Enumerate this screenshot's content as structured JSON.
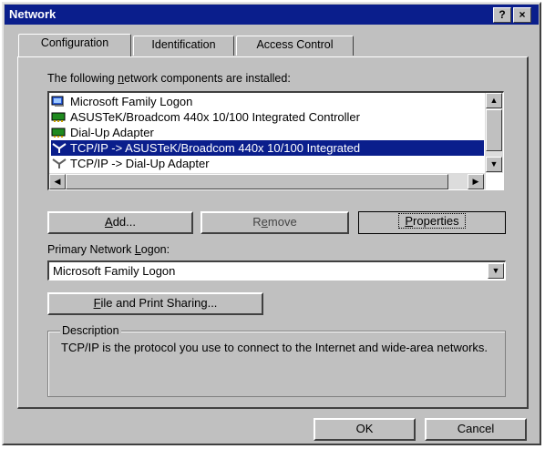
{
  "window": {
    "title": "Network",
    "help_button": "?",
    "close_button": "×"
  },
  "tabs": [
    {
      "label": "Configuration",
      "active": true
    },
    {
      "label": "Identification",
      "active": false
    },
    {
      "label": "Access Control",
      "active": false
    }
  ],
  "components": {
    "label_pre": "The following ",
    "label_mnemonic": "n",
    "label_post": "etwork components are installed:",
    "items": [
      {
        "label": "Microsoft Family Logon",
        "icon": "client-icon",
        "selected": false
      },
      {
        "label": "ASUSTeK/Broadcom 440x 10/100 Integrated Controller",
        "icon": "network-adapter-icon",
        "selected": false
      },
      {
        "label": "Dial-Up Adapter",
        "icon": "network-adapter-icon",
        "selected": false
      },
      {
        "label": "TCP/IP -> ASUSTeK/Broadcom 440x 10/100 Integrated",
        "icon": "protocol-icon",
        "selected": true
      },
      {
        "label": "TCP/IP -> Dial-Up Adapter",
        "icon": "protocol-icon",
        "selected": false
      }
    ]
  },
  "buttons": {
    "add_mnemonic": "A",
    "add_rest": "dd...",
    "remove_pre": "R",
    "remove_mnemonic": "e",
    "remove_rest": "move",
    "properties_mnemonic": "P",
    "properties_rest": "roperties",
    "file_sharing_mnemonic": "F",
    "file_sharing_rest": "ile and Print Sharing...",
    "ok": "OK",
    "cancel": "Cancel"
  },
  "primary_logon": {
    "label_pre": "Primary Network ",
    "label_mnemonic": "L",
    "label_post": "ogon:",
    "value": "Microsoft Family Logon"
  },
  "description": {
    "legend": "Description",
    "text": "TCP/IP is the protocol you use to connect to the Internet and wide-area networks."
  }
}
